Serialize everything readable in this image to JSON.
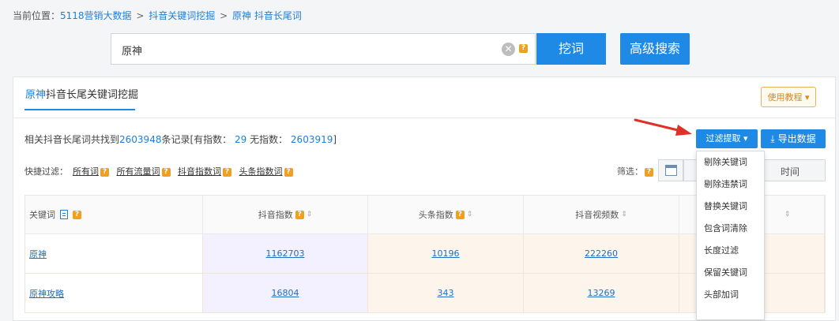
{
  "breadcrumb": {
    "prefix": "当前位置：",
    "items": [
      "5118营销大数据",
      "抖音关键词挖掘",
      "原神 抖音长尾词"
    ],
    "separator": ">"
  },
  "search": {
    "value": "原神",
    "help_icon": "?"
  },
  "buttons": {
    "dig": "挖词",
    "advanced": "高级搜索",
    "tutorial": "使用教程",
    "filter": "过滤提取",
    "export": "导出数据"
  },
  "panel": {
    "title_keyword": "原神",
    "title_rest": "抖音长尾关键词挖掘"
  },
  "stats": {
    "part1": "相关抖音长尾词共找到",
    "total": "2603948",
    "part2": "条记录[有指数：",
    "with_index": "29",
    "part3": " 无指数：",
    "without_index": "2603919",
    "part4": "]"
  },
  "quick_filter": {
    "label": "快捷过滤：",
    "items": [
      "所有词",
      "所有流量词",
      "抖音指数词",
      "头条指数词"
    ]
  },
  "screen": {
    "label": "筛选：",
    "date_text": "时间"
  },
  "table": {
    "headers": [
      "关键词",
      "抖音指数",
      "头条指数",
      "抖音视频数",
      ""
    ],
    "rows": [
      [
        "原神",
        "1162703",
        "10196",
        "222260",
        ""
      ],
      [
        "原神攻略",
        "16804",
        "343",
        "13269",
        ""
      ]
    ]
  },
  "dropdown": {
    "items": [
      "剔除关键词",
      "剔除违禁词",
      "替换关键词",
      "包含词清除",
      "长度过滤",
      "保留关键词",
      "头部加词"
    ]
  },
  "colors": {
    "accent": "#1f8ae6",
    "help": "#f0a020",
    "annotation_arrow": "#e0302a"
  },
  "icons": [
    "clear-icon",
    "help-icon",
    "caret-down-icon",
    "download-icon",
    "calendar-icon",
    "copy-icon",
    "sort-icon",
    "arrow-annotation"
  ]
}
